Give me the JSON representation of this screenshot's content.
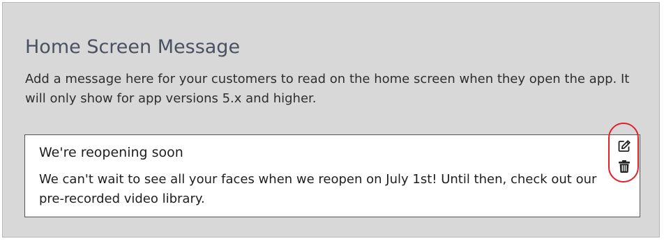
{
  "section": {
    "title": "Home Screen Message",
    "description": "Add a message here for your customers to read on the home screen when they open the app. It will only show for app versions 5.x and higher."
  },
  "message": {
    "title": "We're reopening soon",
    "body": "We can't wait to see all your faces when we reopen on July 1st! Until then, check out our pre-recorded video library."
  },
  "actions": {
    "edit_icon": "edit-icon",
    "delete_icon": "trash-icon"
  },
  "colors": {
    "panel_background": "#d8d8d8",
    "title_text": "#4a5160",
    "highlight_ring": "#e0202a"
  }
}
